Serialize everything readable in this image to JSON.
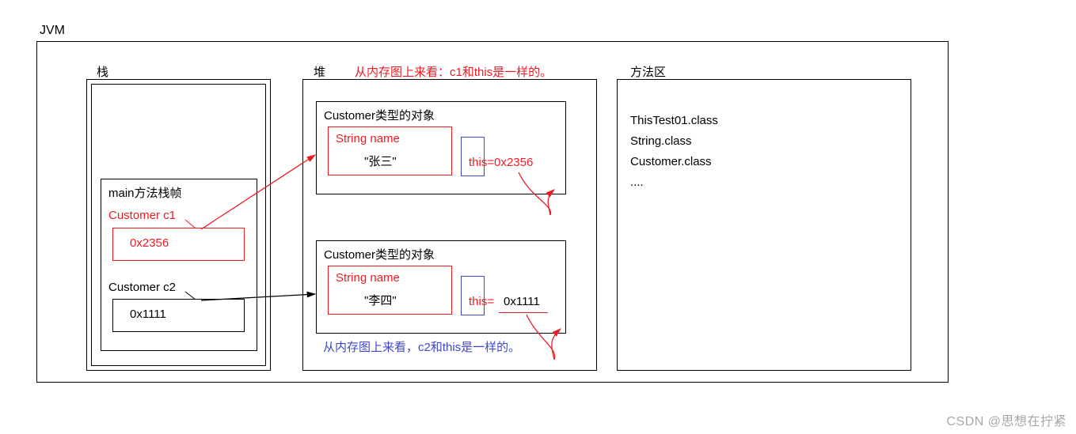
{
  "title": "JVM",
  "stack": {
    "label": "栈",
    "frame_title": "main方法栈帧",
    "c1": {
      "decl": "Customer c1",
      "addr": "0x2356"
    },
    "c2": {
      "decl": "Customer c2",
      "addr": "0x1111"
    }
  },
  "heap": {
    "label": "堆",
    "note_top": "从内存图上来看：c1和this是一样的。",
    "obj1": {
      "title": "Customer类型的对象",
      "field_label": "String name",
      "field_value": "\"张三\"",
      "this_text": "this=0x2356"
    },
    "obj2": {
      "title": "Customer类型的对象",
      "field_label": "String name",
      "field_value": "\"李四\"",
      "this_label": "this=",
      "this_addr": "0x1111"
    },
    "note_bottom": "从内存图上来看，c2和this是一样的。"
  },
  "method_area": {
    "label": "方法区",
    "line1": "ThisTest01.class",
    "line2": "String.class",
    "line3": "Customer.class",
    "line4": "...."
  },
  "watermark": "CSDN @思想在拧紧"
}
